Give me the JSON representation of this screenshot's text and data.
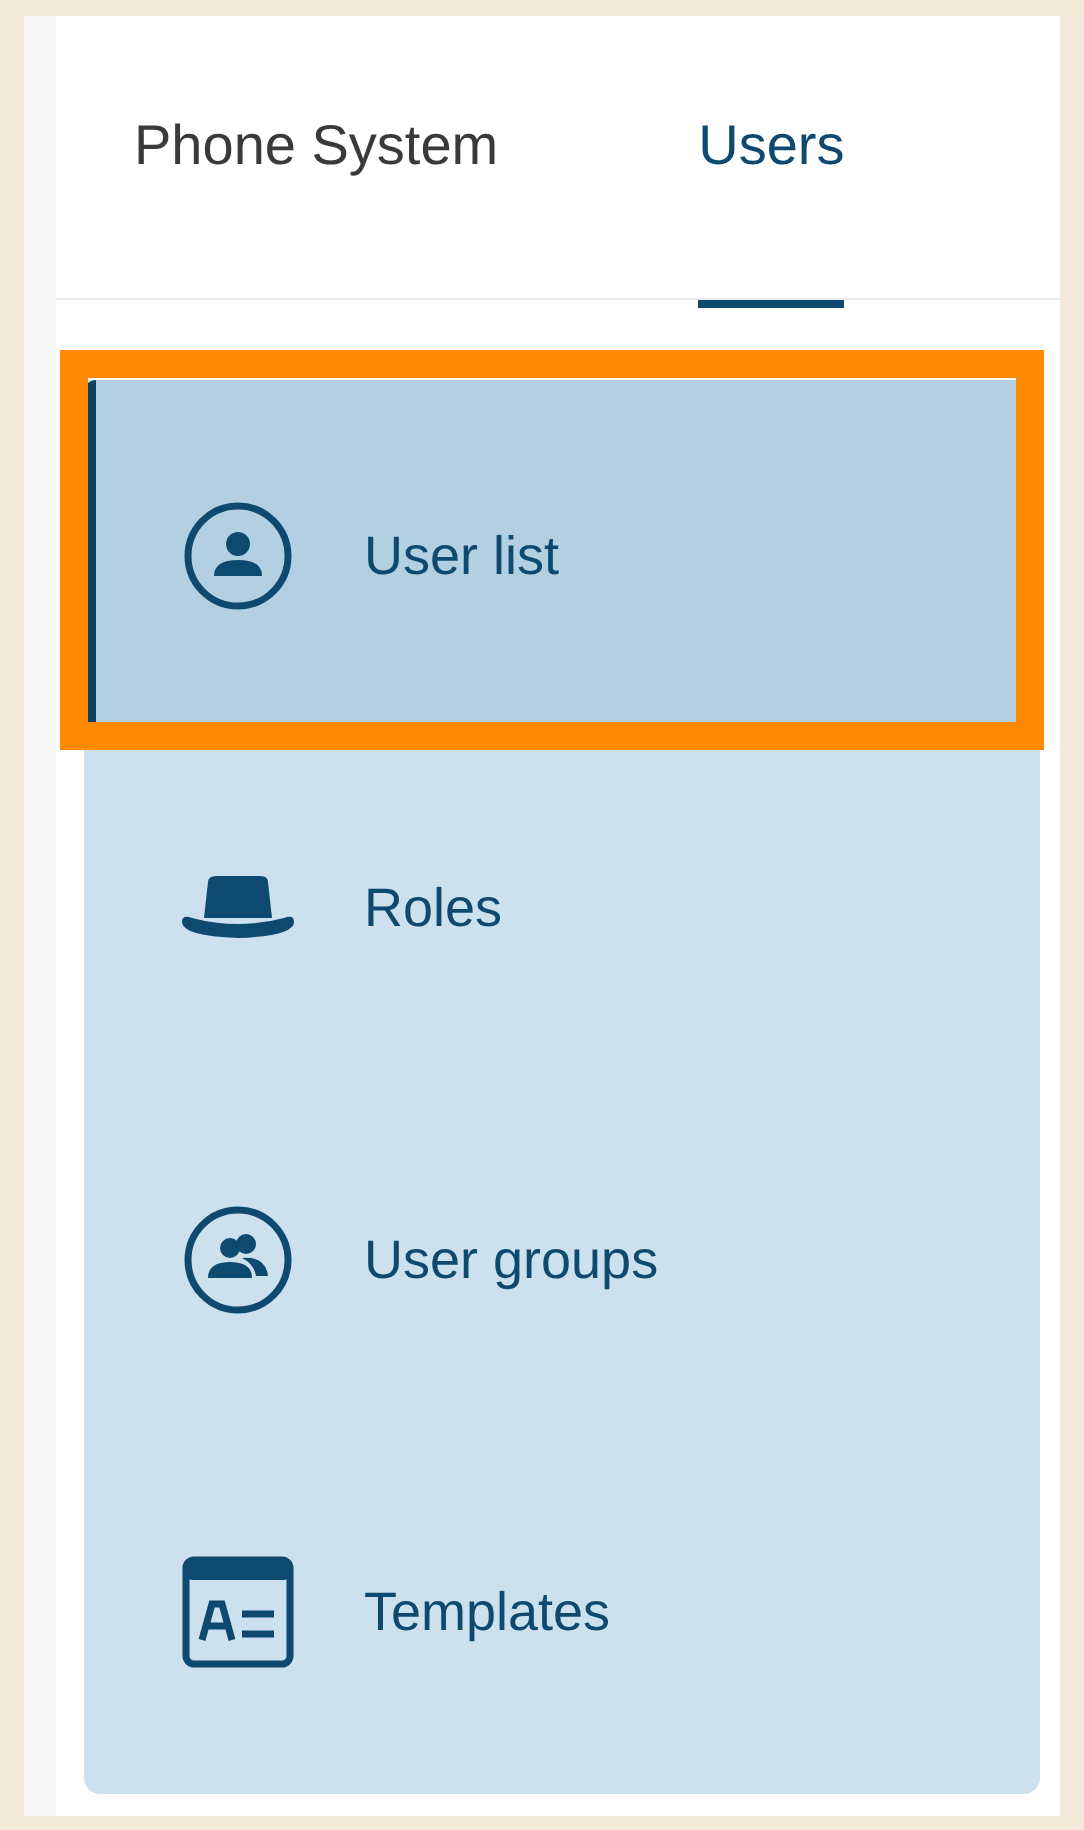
{
  "tabs": [
    {
      "label": "Phone System",
      "selected": false
    },
    {
      "label": "Users",
      "selected": true
    }
  ],
  "menu": [
    {
      "label": "User list",
      "selected": true,
      "highlighted": true
    },
    {
      "label": "Roles",
      "selected": false,
      "highlighted": false
    },
    {
      "label": "User groups",
      "selected": false,
      "highlighted": false
    },
    {
      "label": "Templates",
      "selected": false,
      "highlighted": false
    }
  ]
}
